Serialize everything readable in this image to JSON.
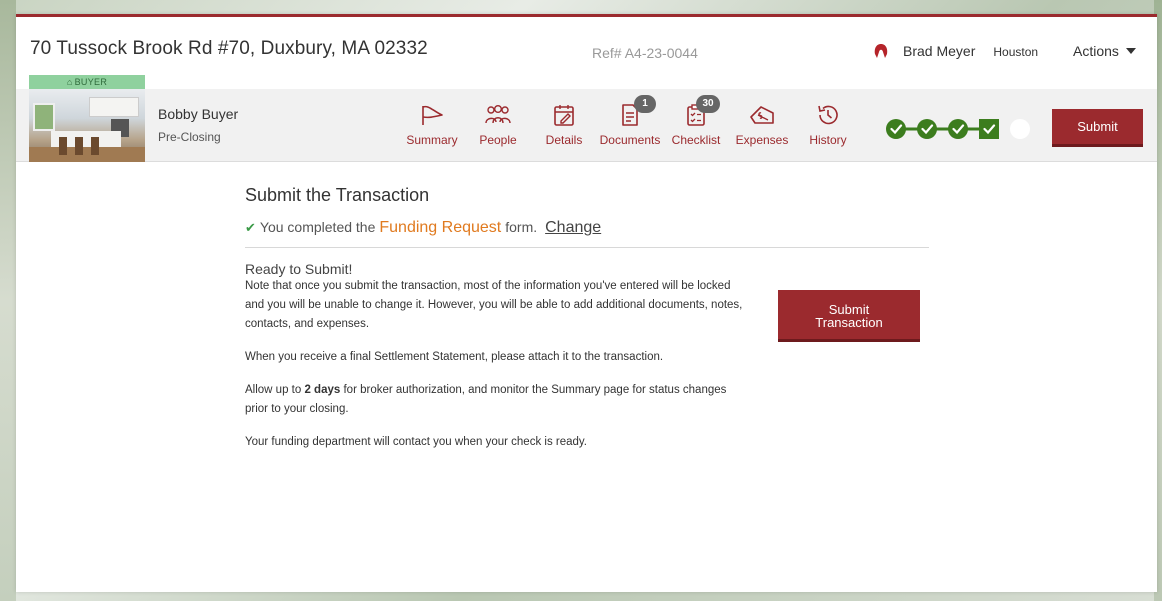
{
  "header": {
    "address": "70 Tussock Brook Rd #70, Duxbury, MA 02332",
    "ref": "Ref# A4-23-0044",
    "user_name": "Brad Meyer",
    "user_location": "Houston",
    "actions_label": "Actions"
  },
  "transaction": {
    "role_tag": "BUYER",
    "client_name": "Bobby Buyer",
    "stage": "Pre-Closing"
  },
  "nav": {
    "items": [
      {
        "label": "Summary",
        "icon": "flag-icon"
      },
      {
        "label": "People",
        "icon": "people-icon"
      },
      {
        "label": "Details",
        "icon": "calendar-edit-icon"
      },
      {
        "label": "Documents",
        "icon": "document-icon",
        "badge": "1"
      },
      {
        "label": "Checklist",
        "icon": "clipboard-checklist-icon",
        "badge": "30"
      },
      {
        "label": "Expenses",
        "icon": "money-tag-icon"
      },
      {
        "label": "History",
        "icon": "history-icon"
      }
    ]
  },
  "progress": {
    "completed_steps": 4,
    "total_steps": 5,
    "color_done": "#3c7d1e",
    "color_pending": "#ffffff"
  },
  "submit_top_label": "Submit",
  "main": {
    "title": "Submit the Transaction",
    "completed_prefix": "You completed the",
    "form_name": "Funding Request",
    "completed_suffix": "form.",
    "change_label": "Change",
    "ready_title": "Ready to Submit!",
    "para1": "Note that once you submit the transaction, most of the information you've entered will be locked and you will be unable to change it. However, you will be able to add additional documents, notes, contacts, and expenses.",
    "para2": "When you receive a final Settlement Statement, please attach it to the transaction.",
    "para3_prefix": "Allow up to",
    "para3_bold": "2 days",
    "para3_suffix": "for broker authorization, and monitor the Summary page for status changes prior to your closing.",
    "para4": "Your funding department will contact you when your check is ready.",
    "submit_line1": "Submit",
    "submit_line2": "Transaction"
  },
  "colors": {
    "accent": "#9b2a2e",
    "form_link": "#e07a1f",
    "buyer_tag": "#8fd19e"
  }
}
